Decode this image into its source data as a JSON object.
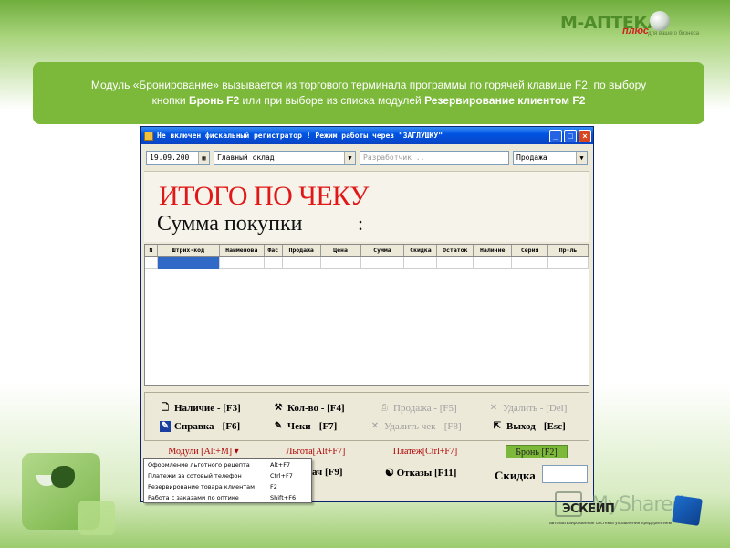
{
  "logo": {
    "main": "M-АПТЕКА",
    "plus": "плюс",
    "tag": "для вашего бизнеса"
  },
  "banner": {
    "line1": "Модуль «Бронирование» вызывается из торгового терминала программы по горячей клавише F2, по выбору",
    "line2_prefix": "кнопки ",
    "line2_bold1": "Бронь F2",
    "line2_mid": " или при выборе из списка модулей ",
    "line2_bold2": "Резервирование клиентом F2"
  },
  "window": {
    "title": "Не включен фискальный регистратор !  Режим работы через \"ЗАГЛУШКУ\"",
    "controls": {
      "minimize": "_",
      "maximize": "□",
      "close": "×"
    },
    "toolbar": {
      "date": "19.09.200",
      "warehouse": "Главный склад",
      "developer": "Разработчик ..",
      "mode": "Продажа"
    },
    "total_title": "ИТОГО ПО ЧЕКУ",
    "sum_label": "Сумма  покупки",
    "sum_colon": ":",
    "grid_columns": [
      "N",
      "Штрих-код",
      "Наименова",
      "Фас",
      "Продажа",
      "Цена",
      "Сумма",
      "Скидка",
      "Остаток",
      "Наличие",
      "Серия",
      "Пр-ль"
    ],
    "buttons": {
      "nalichie": "Наличие - [F3]",
      "kolvo": "Кол-во - [F4]",
      "prodazha": "Продажа - [F5]",
      "udalit": "Удалить - [Del]",
      "spravka": "Справка - [F6]",
      "cheki": "Чеки - [F7]",
      "udalit_chek": "Удалить чек - [F8]",
      "vyhod": "Выход - [Esc]"
    },
    "modules_row": {
      "modules": "Модули [Alt+M]",
      "lgota": "Льгота[Alt+F7]",
      "platezh": "Платеж[Ctrl+F7]",
      "bron": "Бронь [F2]"
    },
    "bottom_row": {
      "f9": "ач [F9]",
      "otkazy": "Отказы [F11]",
      "skidka": "Скидка"
    }
  },
  "context_menu": [
    {
      "label": "Оформление льготного рецепта",
      "shortcut": "Alt+F7"
    },
    {
      "label": "Платежи за сотовый телефон",
      "shortcut": "Ctrl+F7"
    },
    {
      "label": "Резервирование товара клиентам",
      "shortcut": "F2"
    },
    {
      "label": "Работа с заказами по оптике",
      "shortcut": "Shift+F6"
    }
  ],
  "watermark": "MyShared",
  "eskeip": {
    "name": "ЭСКЕЙП",
    "sub": "автоматизированные системы управления предприятием"
  },
  "colors": {
    "accent_green": "#7cb83a",
    "title_red": "#e01818",
    "xp_blue": "#0054e3"
  }
}
